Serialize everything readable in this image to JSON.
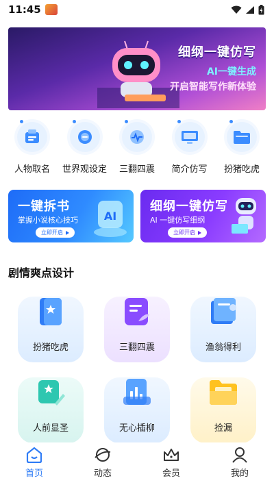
{
  "status": {
    "time": "11:45"
  },
  "hero": {
    "title": "细纲一键仿写",
    "line1": "AI一键生成",
    "line2": "开启智能写作新体验"
  },
  "tools": [
    {
      "label": "人物取名",
      "icon": "name-card-icon"
    },
    {
      "label": "世界观设定",
      "icon": "globe-icon"
    },
    {
      "label": "三翻四震",
      "icon": "pulse-icon"
    },
    {
      "label": "简介仿写",
      "icon": "monitor-icon"
    },
    {
      "label": "扮猪吃虎",
      "icon": "folder-icon"
    }
  ],
  "promos": {
    "left": {
      "title": "一键拆书",
      "subtitle": "掌握小说核心技巧",
      "button": "立即开启"
    },
    "right": {
      "title": "细纲一键仿写",
      "subtitle": "AI 一键仿写细纲",
      "button": "立即开启"
    }
  },
  "section": {
    "title": "剧情爽点设计"
  },
  "grid": [
    {
      "label": "扮猪吃虎",
      "icon": "book-star-icon"
    },
    {
      "label": "三翻四震",
      "icon": "note-pen-icon"
    },
    {
      "label": "渔翁得利",
      "icon": "book-icon"
    },
    {
      "label": "人前显圣",
      "icon": "star-pen-icon"
    },
    {
      "label": "无心插柳",
      "icon": "chart-doc-icon"
    },
    {
      "label": "捡漏",
      "icon": "folder-icon"
    }
  ],
  "nav": [
    {
      "label": "首页",
      "icon": "home-icon",
      "active": true
    },
    {
      "label": "动态",
      "icon": "planet-icon",
      "active": false
    },
    {
      "label": "会员",
      "icon": "crown-icon",
      "active": false
    },
    {
      "label": "我的",
      "icon": "user-icon",
      "active": false
    }
  ],
  "colors": {
    "accent": "#2f7cf6",
    "promo_blue": "#1e6cf7",
    "promo_purple": "#6a2bf0"
  }
}
